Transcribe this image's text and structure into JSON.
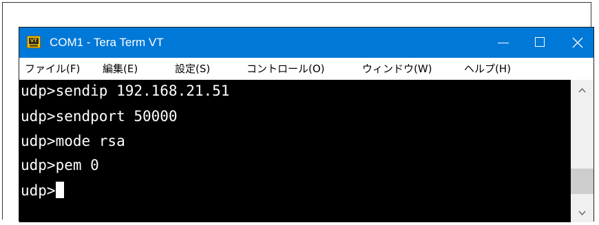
{
  "window": {
    "title": "COM1 - Tera Term VT",
    "icon": "tera-term-vt-icon",
    "icon_text": "VT",
    "titlebar_color": "#0078d7",
    "controls": [
      "minimize-icon",
      "maximize-icon",
      "close-icon"
    ]
  },
  "menu": {
    "items": [
      {
        "label": "ファイル(F)"
      },
      {
        "label": "編集(E)"
      },
      {
        "label": "設定(S)"
      },
      {
        "label": "コントロール(O)"
      },
      {
        "label": "ウィンドウ(W)"
      },
      {
        "label": "ヘルプ(H)"
      }
    ]
  },
  "terminal": {
    "background": "#000000",
    "foreground": "#ffffff",
    "lines": [
      "udp>sendip 192.168.21.51",
      "udp>sendport 50000",
      "udp>mode rsa",
      "udp>pem 0",
      "udp>"
    ]
  },
  "scrollbar": {
    "up_icon": "chevron-up-icon",
    "down_icon": "chevron-down-icon"
  }
}
